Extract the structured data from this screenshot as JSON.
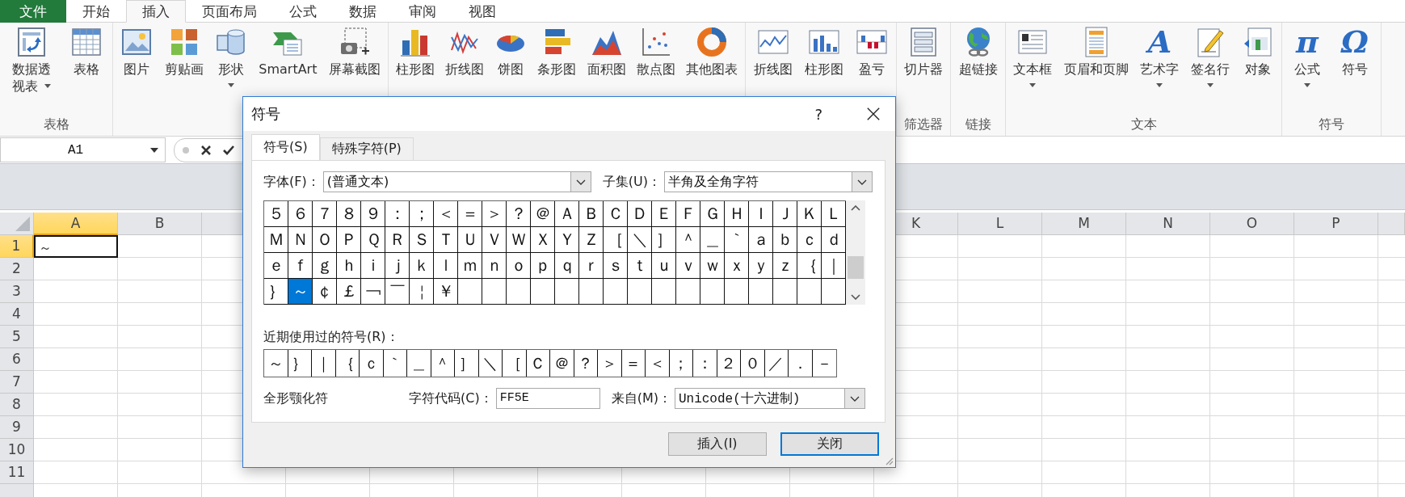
{
  "tabs": [
    {
      "label": "文件",
      "kind": "file",
      "selected": false
    },
    {
      "label": "开始",
      "kind": "tab",
      "selected": false
    },
    {
      "label": "插入",
      "kind": "tab",
      "selected": true
    },
    {
      "label": "页面布局",
      "kind": "tab",
      "selected": false
    },
    {
      "label": "公式",
      "kind": "tab",
      "selected": false
    },
    {
      "label": "数据",
      "kind": "tab",
      "selected": false
    },
    {
      "label": "审阅",
      "kind": "tab",
      "selected": false
    },
    {
      "label": "视图",
      "kind": "tab",
      "selected": false
    }
  ],
  "ribbon": {
    "groups": [
      {
        "label": "表格",
        "items": [
          {
            "label": "数据透视表",
            "kind": "pivot",
            "dropdown": true
          },
          {
            "label": "表格",
            "kind": "table",
            "dropdown": false
          }
        ]
      },
      {
        "items": [
          {
            "label": "图片",
            "kind": "picture",
            "dropdown": false
          },
          {
            "label": "剪贴画",
            "kind": "clipart",
            "dropdown": false
          },
          {
            "label": "形状",
            "kind": "shapes",
            "dropdown": true
          },
          {
            "label": "SmartArt",
            "kind": "smartart",
            "dropdown": false
          },
          {
            "label": "屏幕截图",
            "kind": "screenshot",
            "dropdown": false
          }
        ]
      },
      {
        "items": [
          {
            "label": "柱形图",
            "kind": "column",
            "dropdown": false
          },
          {
            "label": "折线图",
            "kind": "line",
            "dropdown": false
          },
          {
            "label": "饼图",
            "kind": "pie",
            "dropdown": false
          },
          {
            "label": "条形图",
            "kind": "bar",
            "dropdown": false
          },
          {
            "label": "面积图",
            "kind": "area",
            "dropdown": false
          },
          {
            "label": "散点图",
            "kind": "scatter",
            "dropdown": false
          },
          {
            "label": "其他图表",
            "kind": "donut",
            "dropdown": false
          }
        ]
      },
      {
        "items": [
          {
            "label": "折线图",
            "kind": "sparkline",
            "dropdown": false
          },
          {
            "label": "柱形图",
            "kind": "sparkcolumn",
            "dropdown": false
          },
          {
            "label": "盈亏",
            "kind": "winloss",
            "dropdown": false
          }
        ]
      },
      {
        "label": "筛选器",
        "items": [
          {
            "label": "切片器",
            "kind": "slicer",
            "dropdown": false
          }
        ]
      },
      {
        "label": "链接",
        "items": [
          {
            "label": "超链接",
            "kind": "hyperlink",
            "dropdown": false
          }
        ]
      },
      {
        "label": "文本",
        "items": [
          {
            "label": "文本框",
            "kind": "textbox",
            "dropdown": true
          },
          {
            "label": "页眉和页脚",
            "kind": "headerfooter",
            "dropdown": false
          },
          {
            "label": "艺术字",
            "kind": "wordart",
            "glyph": "A",
            "dropdown": true
          },
          {
            "label": "签名行",
            "kind": "signature",
            "dropdown": true
          },
          {
            "label": "对象",
            "kind": "object",
            "dropdown": false
          }
        ]
      },
      {
        "label": "符号",
        "items": [
          {
            "label": "公式",
            "kind": "equation",
            "glyph": "π",
            "dropdown": true
          },
          {
            "label": "符号",
            "kind": "symbol",
            "glyph": "Ω",
            "dropdown": false
          }
        ]
      }
    ]
  },
  "formula_bar": {
    "name_box": "A1"
  },
  "sheet": {
    "columns_left": [
      {
        "label": "A",
        "selected": true
      },
      {
        "label": "B",
        "selected": false
      }
    ],
    "columns_right": [
      {
        "label": "K",
        "selected": false
      },
      {
        "label": "L",
        "selected": false
      },
      {
        "label": "M",
        "selected": false
      },
      {
        "label": "N",
        "selected": false
      },
      {
        "label": "O",
        "selected": false
      },
      {
        "label": "P",
        "selected": false
      }
    ],
    "rows": [
      {
        "label": "1",
        "selected": true,
        "values": [
          "～"
        ]
      },
      {
        "label": "2",
        "selected": false
      },
      {
        "label": "3",
        "selected": false
      },
      {
        "label": "4",
        "selected": false
      },
      {
        "label": "5",
        "selected": false
      },
      {
        "label": "6",
        "selected": false
      },
      {
        "label": "7",
        "selected": false
      },
      {
        "label": "8",
        "selected": false
      },
      {
        "label": "9",
        "selected": false
      },
      {
        "label": "10",
        "selected": false
      },
      {
        "label": "11",
        "selected": false
      }
    ]
  },
  "dialog": {
    "title": "符号",
    "help": "?",
    "tabs": [
      {
        "label": "符号(S)",
        "selected": true
      },
      {
        "label": "特殊字符(P)",
        "selected": false
      }
    ],
    "font": {
      "label": "字体(F)：",
      "value": "(普通文本)"
    },
    "subset": {
      "label": "子集(U)：",
      "value": "半角及全角字符"
    },
    "symbols": [
      {
        "char": "５",
        "selected": false
      },
      {
        "char": "６",
        "selected": false
      },
      {
        "char": "７",
        "selected": false
      },
      {
        "char": "８",
        "selected": false
      },
      {
        "char": "９",
        "selected": false
      },
      {
        "char": "：",
        "selected": false
      },
      {
        "char": "；",
        "selected": false
      },
      {
        "char": "＜",
        "selected": false
      },
      {
        "char": "＝",
        "selected": false
      },
      {
        "char": "＞",
        "selected": false
      },
      {
        "char": "？",
        "selected": false
      },
      {
        "char": "＠",
        "selected": false
      },
      {
        "char": "Ａ",
        "selected": false
      },
      {
        "char": "Ｂ",
        "selected": false
      },
      {
        "char": "Ｃ",
        "selected": false
      },
      {
        "char": "Ｄ",
        "selected": false
      },
      {
        "char": "Ｅ",
        "selected": false
      },
      {
        "char": "Ｆ",
        "selected": false
      },
      {
        "char": "Ｇ",
        "selected": false
      },
      {
        "char": "Ｈ",
        "selected": false
      },
      {
        "char": "Ｉ",
        "selected": false
      },
      {
        "char": "Ｊ",
        "selected": false
      },
      {
        "char": "Ｋ",
        "selected": false
      },
      {
        "char": "Ｌ",
        "selected": false
      },
      {
        "char": "Ｍ",
        "selected": false
      },
      {
        "char": "Ｎ",
        "selected": false
      },
      {
        "char": "Ｏ",
        "selected": false
      },
      {
        "char": "Ｐ",
        "selected": false
      },
      {
        "char": "Ｑ",
        "selected": false
      },
      {
        "char": "Ｒ",
        "selected": false
      },
      {
        "char": "Ｓ",
        "selected": false
      },
      {
        "char": "Ｔ",
        "selected": false
      },
      {
        "char": "Ｕ",
        "selected": false
      },
      {
        "char": "Ｖ",
        "selected": false
      },
      {
        "char": "Ｗ",
        "selected": false
      },
      {
        "char": "Ｘ",
        "selected": false
      },
      {
        "char": "Ｙ",
        "selected": false
      },
      {
        "char": "Ｚ",
        "selected": false
      },
      {
        "char": "［",
        "selected": false
      },
      {
        "char": "＼",
        "selected": false
      },
      {
        "char": "］",
        "selected": false
      },
      {
        "char": "＾",
        "selected": false
      },
      {
        "char": "＿",
        "selected": false
      },
      {
        "char": "｀",
        "selected": false
      },
      {
        "char": "ａ",
        "selected": false
      },
      {
        "char": "ｂ",
        "selected": false
      },
      {
        "char": "ｃ",
        "selected": false
      },
      {
        "char": "ｄ",
        "selected": false
      },
      {
        "char": "ｅ",
        "selected": false
      },
      {
        "char": "ｆ",
        "selected": false
      },
      {
        "char": "ｇ",
        "selected": false
      },
      {
        "char": "ｈ",
        "selected": false
      },
      {
        "char": "ｉ",
        "selected": false
      },
      {
        "char": "ｊ",
        "selected": false
      },
      {
        "char": "ｋ",
        "selected": false
      },
      {
        "char": "ｌ",
        "selected": false
      },
      {
        "char": "ｍ",
        "selected": false
      },
      {
        "char": "ｎ",
        "selected": false
      },
      {
        "char": "ｏ",
        "selected": false
      },
      {
        "char": "ｐ",
        "selected": false
      },
      {
        "char": "ｑ",
        "selected": false
      },
      {
        "char": "ｒ",
        "selected": false
      },
      {
        "char": "ｓ",
        "selected": false
      },
      {
        "char": "ｔ",
        "selected": false
      },
      {
        "char": "ｕ",
        "selected": false
      },
      {
        "char": "ｖ",
        "selected": false
      },
      {
        "char": "ｗ",
        "selected": false
      },
      {
        "char": "ｘ",
        "selected": false
      },
      {
        "char": "ｙ",
        "selected": false
      },
      {
        "char": "ｚ",
        "selected": false
      },
      {
        "char": "｛",
        "selected": false
      },
      {
        "char": "｜",
        "selected": false
      },
      {
        "char": "｝",
        "selected": false
      },
      {
        "char": "～",
        "selected": true
      },
      {
        "char": "￠",
        "selected": false
      },
      {
        "char": "￡",
        "selected": false
      },
      {
        "char": "￢",
        "selected": false
      },
      {
        "char": "￣",
        "selected": false
      },
      {
        "char": "￤",
        "selected": false
      },
      {
        "char": "￥",
        "selected": false
      }
    ],
    "recent_label": "近期使用过的符号(R)：",
    "recent": [
      "～",
      "｝",
      "｜",
      "｛",
      "ｃ",
      "｀",
      "＿",
      "＾",
      "］",
      "＼",
      "［",
      "Ｃ",
      "＠",
      "？",
      "＞",
      "＝",
      "＜",
      "；",
      "：",
      "２",
      "０",
      "／",
      "．",
      "－"
    ],
    "char_name": "全形颚化符",
    "char_code": {
      "label": "字符代码(C)：",
      "value": "FF5E"
    },
    "from": {
      "label": "来自(M)：",
      "value": "Unicode(十六进制)"
    },
    "buttons": [
      {
        "label": "插入(I)",
        "focused": false
      },
      {
        "label": "关闭",
        "focused": true
      }
    ]
  }
}
